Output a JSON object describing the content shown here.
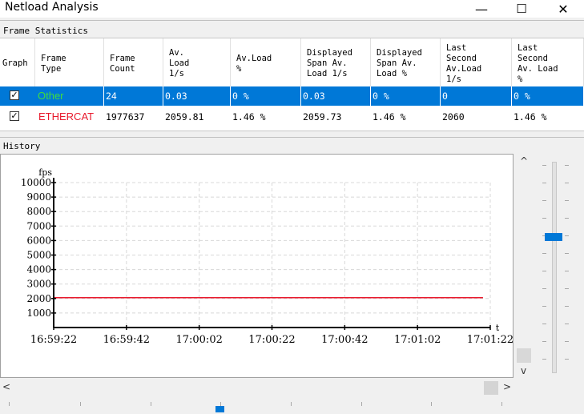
{
  "window": {
    "title": "Netload Analysis",
    "minimize_label": "—",
    "maximize_label": "☐",
    "close_label": "✕"
  },
  "frame_stats": {
    "label": "Frame Statistics",
    "columns": [
      "Graph",
      "Frame\nType",
      "Frame\nCount",
      "Av.\nLoad\n1/s",
      "Av.Load\n%",
      "Displayed\nSpan Av.\nLoad 1/s",
      "Displayed\nSpan Av.\nLoad %",
      "Last\nSecond\nAv.Load\n1/s",
      "Last\nSecond\nAv. Load\n%"
    ],
    "rows": [
      {
        "checked": true,
        "check_glyph": "✓",
        "type": "Other",
        "count": "24",
        "av_load": "0.03",
        "av_pct": "0 %",
        "span_load": "0.03",
        "span_pct": "0 %",
        "last_load": "0",
        "last_pct": "0 %",
        "type_color": "#3fdc3f",
        "selected": true
      },
      {
        "checked": true,
        "check_glyph": "✓",
        "type": "ETHERCAT",
        "count": "1977637",
        "av_load": "2059.81",
        "av_pct": "1.46 %",
        "span_load": "2059.73",
        "span_pct": "1.46 %",
        "last_load": "2060",
        "last_pct": "1.46 %",
        "type_color": "#e8192c",
        "selected": false
      }
    ],
    "selection_color": "#0078d7"
  },
  "history": {
    "label": "History",
    "scroll_up": "^",
    "scroll_down": "v",
    "scroll_left": "<",
    "scroll_right": ">"
  },
  "chart_data": {
    "type": "line",
    "xlabel": "t",
    "ylabel": "fps",
    "ylim": [
      0,
      10000
    ],
    "yticks": [
      1000,
      2000,
      3000,
      4000,
      5000,
      6000,
      7000,
      8000,
      9000,
      10000
    ],
    "xticks": [
      "16:59:22",
      "16:59:42",
      "17:00:02",
      "17:00:22",
      "17:00:42",
      "17:01:02",
      "17:01:22"
    ],
    "x_range": [
      "16:59:22",
      "17:01:22"
    ],
    "grid": true,
    "series": [
      {
        "values_start": "16:59:22",
        "values_end": "17:01:20",
        "value": 2060,
        "color": "#e8192c"
      }
    ]
  }
}
